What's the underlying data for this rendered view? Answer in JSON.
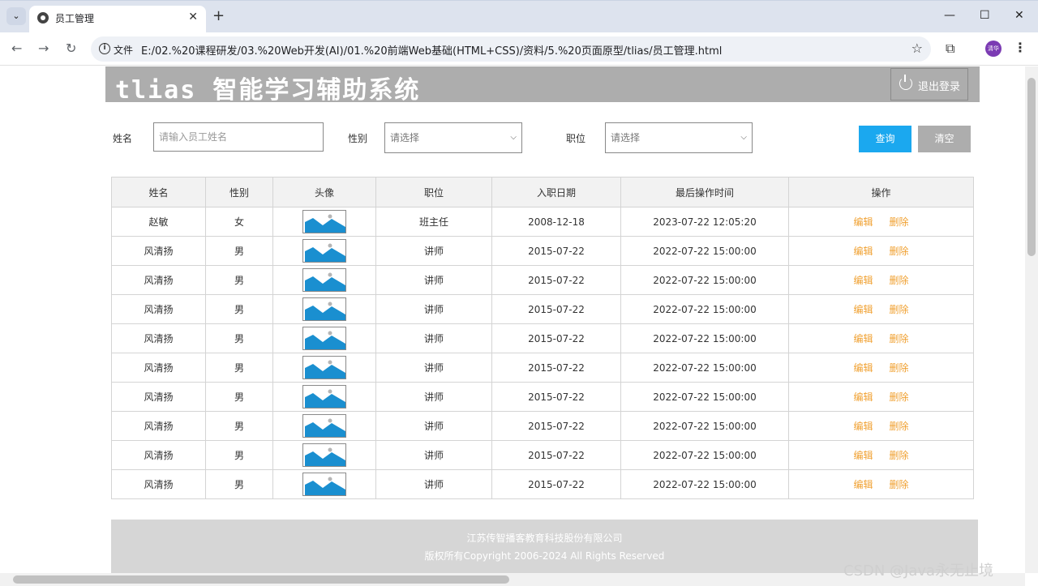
{
  "browser": {
    "tab_title": "员工管理",
    "address_prefix": "文件",
    "url": "E:/02.%20课程研发/03.%20Web开发(AI)/01.%20前端Web基础(HTML+CSS)/资料/5.%20页面原型/tlias/员工管理.html",
    "profile_initials": "清华"
  },
  "header": {
    "app_title": "tlias 智能学习辅助系统",
    "logout_label": "退出登录"
  },
  "search": {
    "name_label": "姓名",
    "name_placeholder": "请输入员工姓名",
    "gender_label": "性别",
    "gender_selected": "请选择",
    "job_label": "职位",
    "job_selected": "请选择",
    "query_label": "查询",
    "clear_label": "清空"
  },
  "table": {
    "headers": [
      "姓名",
      "性别",
      "头像",
      "职位",
      "入职日期",
      "最后操作时间",
      "操作"
    ],
    "rows": [
      {
        "name": "赵敏",
        "gender": "女",
        "job": "班主任",
        "entry_date": "2008-12-18",
        "update_time": "2023-07-22 12:05:20"
      },
      {
        "name": "风清扬",
        "gender": "男",
        "job": "讲师",
        "entry_date": "2015-07-22",
        "update_time": "2022-07-22 15:00:00"
      },
      {
        "name": "风清扬",
        "gender": "男",
        "job": "讲师",
        "entry_date": "2015-07-22",
        "update_time": "2022-07-22 15:00:00"
      },
      {
        "name": "风清扬",
        "gender": "男",
        "job": "讲师",
        "entry_date": "2015-07-22",
        "update_time": "2022-07-22 15:00:00"
      },
      {
        "name": "风清扬",
        "gender": "男",
        "job": "讲师",
        "entry_date": "2015-07-22",
        "update_time": "2022-07-22 15:00:00"
      },
      {
        "name": "风清扬",
        "gender": "男",
        "job": "讲师",
        "entry_date": "2015-07-22",
        "update_time": "2022-07-22 15:00:00"
      },
      {
        "name": "风清扬",
        "gender": "男",
        "job": "讲师",
        "entry_date": "2015-07-22",
        "update_time": "2022-07-22 15:00:00"
      },
      {
        "name": "风清扬",
        "gender": "男",
        "job": "讲师",
        "entry_date": "2015-07-22",
        "update_time": "2022-07-22 15:00:00"
      },
      {
        "name": "风清扬",
        "gender": "男",
        "job": "讲师",
        "entry_date": "2015-07-22",
        "update_time": "2022-07-22 15:00:00"
      },
      {
        "name": "风清扬",
        "gender": "男",
        "job": "讲师",
        "entry_date": "2015-07-22",
        "update_time": "2022-07-22 15:00:00"
      }
    ],
    "edit_label": "编辑",
    "delete_label": "删除"
  },
  "footer": {
    "company": "江苏传智播客教育科技股份有限公司",
    "copyright": "版权所有Copyright 2006-2024  All Rights Reserved"
  },
  "watermark": "CSDN @Java永无止境",
  "colors": {
    "accent": "#1ba8ef",
    "header_bg": "#adadad",
    "link": "#f0a030"
  }
}
